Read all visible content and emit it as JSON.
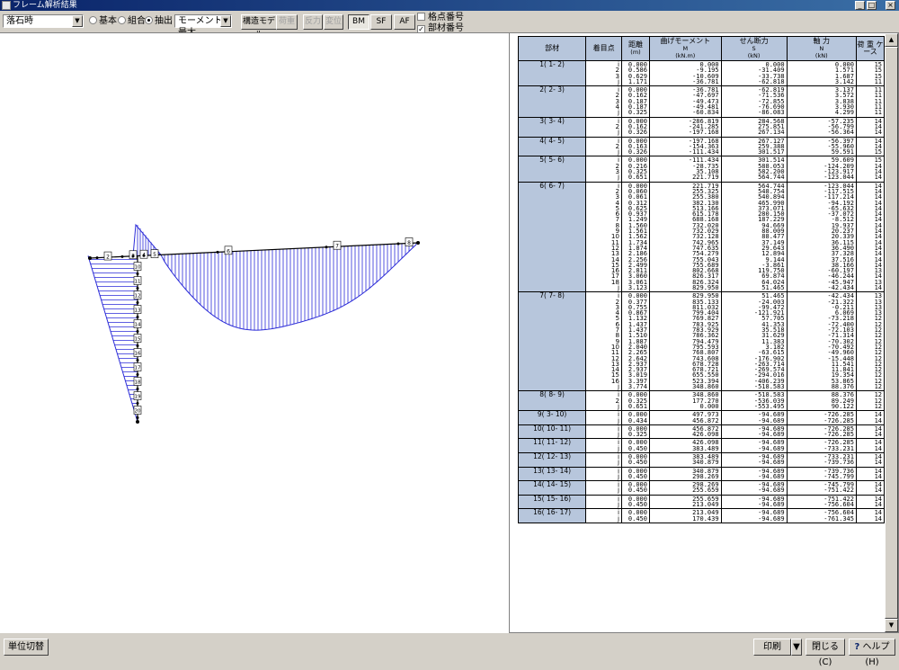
{
  "window": {
    "title": "フレーム解析結果",
    "min_label": "_",
    "max_label": "□",
    "close_label": "×"
  },
  "toolbar": {
    "case_select": "落石時",
    "radio_basic": "基本",
    "radio_combo": "組合",
    "radio_extract": "抽出",
    "selected_radio": "抽出",
    "moment_select": "モーメント最大",
    "btn_model": "構造モデル",
    "btn_load": "荷重",
    "btn_reaction": "反力",
    "btn_disp": "変位",
    "btn_bm": "BM",
    "btn_sf": "SF",
    "btn_af": "AF",
    "chk_node": "格点番号",
    "chk_node_checked": false,
    "chk_member": "部材番号",
    "chk_member_checked": true
  },
  "table": {
    "headers": {
      "member": "部材",
      "point": "着目点",
      "dist": "距離",
      "dist_unit": "(m)",
      "moment": "曲げモーメント",
      "moment_sym": "M",
      "moment_unit": "(kN.m)",
      "shear": "せん断力",
      "shear_sym": "S",
      "shear_unit": "(kN)",
      "axial": "軸 力",
      "axial_sym": "N",
      "axial_unit": "(kN)",
      "case": "荷 重 ケース"
    },
    "blocks": [
      {
        "member": "1( 1- 2)",
        "rows": [
          [
            "i",
            "0.000",
            "0.000",
            "0.000",
            "0.000",
            "15"
          ],
          [
            "2",
            "0.586",
            "-9.195",
            "-31.409",
            "1.571",
            "15"
          ],
          [
            "3",
            "0.629",
            "-10.609",
            "-33.738",
            "1.687",
            "15"
          ],
          [
            "j",
            "1.171",
            "-36.781",
            "-62.818",
            "3.142",
            "11"
          ]
        ]
      },
      {
        "member": "2( 2- 3)",
        "rows": [
          [
            "i",
            "0.000",
            "-36.781",
            "-62.819",
            "3.137",
            "11"
          ],
          [
            "2",
            "0.162",
            "-47.697",
            "-71.536",
            "3.572",
            "11"
          ],
          [
            "3",
            "0.187",
            "-49.473",
            "-72.855",
            "3.838",
            "11"
          ],
          [
            "4",
            "0.187",
            "-49.481",
            "-76.690",
            "3.930",
            "11"
          ],
          [
            "j",
            "0.325",
            "-60.834",
            "-86.083",
            "4.299",
            "11"
          ]
        ]
      },
      {
        "member": "3( 3- 4)",
        "rows": [
          [
            "i",
            "0.000",
            "-286.819",
            "284.568",
            "-57.235",
            "14"
          ],
          [
            "2",
            "0.162",
            "-241.285",
            "275.851",
            "-56.799",
            "14"
          ],
          [
            "j",
            "0.326",
            "-197.168",
            "267.134",
            "-56.364",
            "14"
          ]
        ]
      },
      {
        "member": "4( 4- 5)",
        "rows": [
          [
            "i",
            "0.000",
            "-197.168",
            "267.127",
            "-56.397",
            "14"
          ],
          [
            "2",
            "0.163",
            "-154.363",
            "259.388",
            "-55.960",
            "14"
          ],
          [
            "j",
            "0.326",
            "-111.434",
            "301.517",
            "59.591",
            "15"
          ]
        ]
      },
      {
        "member": "5( 5- 6)",
        "rows": [
          [
            "i",
            "0.000",
            "-111.434",
            "301.514",
            "59.609",
            "15"
          ],
          [
            "2",
            "0.216",
            "-28.735",
            "588.053",
            "-124.209",
            "14"
          ],
          [
            "3",
            "0.325",
            "35.108",
            "582.200",
            "-123.917",
            "14"
          ],
          [
            "j",
            "0.651",
            "221.719",
            "564.744",
            "-123.044",
            "14"
          ]
        ]
      },
      {
        "member": "6( 6- 7)",
        "rows": [
          [
            "i",
            "0.000",
            "221.719",
            "564.744",
            "-123.044",
            "14"
          ],
          [
            "2",
            "0.060",
            "255.325",
            "548.754",
            "-117.515",
            "14"
          ],
          [
            "3",
            "0.061",
            "255.380",
            "540.894",
            "-117.214",
            "14"
          ],
          [
            "4",
            "0.312",
            "382.130",
            "465.990",
            "-94.192",
            "14"
          ],
          [
            "5",
            "0.625",
            "513.166",
            "373.071",
            "-65.632",
            "14"
          ],
          [
            "6",
            "0.937",
            "615.178",
            "280.150",
            "-37.072",
            "14"
          ],
          [
            "7",
            "1.249",
            "688.168",
            "187.229",
            "-8.512",
            "14"
          ],
          [
            "8",
            "1.560",
            "732.020",
            "94.669",
            "19.937",
            "14"
          ],
          [
            "9",
            "1.561",
            "732.029",
            "88.009",
            "20.237",
            "14"
          ],
          [
            "10",
            "1.562",
            "732.128",
            "88.477",
            "20.339",
            "14"
          ],
          [
            "11",
            "1.734",
            "742.965",
            "37.149",
            "36.115",
            "14"
          ],
          [
            "12",
            "1.874",
            "747.635",
            "29.643",
            "36.490",
            "14"
          ],
          [
            "13",
            "2.186",
            "754.279",
            "12.894",
            "37.328",
            "14"
          ],
          [
            "14",
            "2.256",
            "755.043",
            "9.144",
            "37.516",
            "14"
          ],
          [
            "15",
            "2.499",
            "755.689",
            "-3.861",
            "38.166",
            "14"
          ],
          [
            "16",
            "2.811",
            "802.668",
            "119.750",
            "-60.197",
            "13"
          ],
          [
            "17",
            "3.060",
            "826.317",
            "69.874",
            "-46.244",
            "14"
          ],
          [
            "18",
            "3.061",
            "826.324",
            "64.024",
            "-45.947",
            "13"
          ],
          [
            "j",
            "3.123",
            "829.950",
            "51.465",
            "-42.434",
            "14"
          ]
        ]
      },
      {
        "member": "7( 7- 8)",
        "rows": [
          [
            "i",
            "0.000",
            "829.950",
            "51.465",
            "-42.434",
            "13"
          ],
          [
            "2",
            "0.377",
            "835.133",
            "-24.003",
            "-21.322",
            "13"
          ],
          [
            "3",
            "0.755",
            "811.032",
            "-99.472",
            "-0.211",
            "13"
          ],
          [
            "4",
            "0.867",
            "799.404",
            "-121.921",
            "6.069",
            "13"
          ],
          [
            "5",
            "1.132",
            "769.827",
            "57.705",
            "-73.218",
            "12"
          ],
          [
            "6",
            "1.437",
            "783.925",
            "41.353",
            "-72.400",
            "12"
          ],
          [
            "7",
            "1.437",
            "783.929",
            "35.518",
            "-72.103",
            "12"
          ],
          [
            "8",
            "1.510",
            "786.362",
            "31.629",
            "-71.314",
            "12"
          ],
          [
            "9",
            "1.887",
            "794.479",
            "11.383",
            "-70.302",
            "12"
          ],
          [
            "10",
            "2.040",
            "795.593",
            "3.182",
            "-70.492",
            "12"
          ],
          [
            "11",
            "2.265",
            "768.807",
            "-63.615",
            "-49.960",
            "12"
          ],
          [
            "12",
            "2.642",
            "743.608",
            "-176.902",
            "-15.448",
            "12"
          ],
          [
            "13",
            "2.937",
            "678.728",
            "-263.714",
            "11.541",
            "12"
          ],
          [
            "14",
            "2.937",
            "678.721",
            "-269.574",
            "11.841",
            "12"
          ],
          [
            "15",
            "3.019",
            "655.550",
            "-294.016",
            "19.354",
            "12"
          ],
          [
            "16",
            "3.397",
            "523.394",
            "-406.239",
            "53.865",
            "12"
          ],
          [
            "j",
            "3.774",
            "348.860",
            "-518.583",
            "88.376",
            "12"
          ]
        ]
      },
      {
        "member": "8( 8- 9)",
        "rows": [
          [
            "i",
            "0.000",
            "348.860",
            "-518.583",
            "88.376",
            "12"
          ],
          [
            "2",
            "0.325",
            "177.270",
            "-536.039",
            "89.249",
            "12"
          ],
          [
            "j",
            "0.651",
            "0.000",
            "-553.495",
            "90.122",
            "12"
          ]
        ]
      },
      {
        "member": "9( 3- 10)",
        "rows": [
          [
            "i",
            "0.000",
            "497.973",
            "-94.689",
            "-726.285",
            "14"
          ],
          [
            "j",
            "0.434",
            "456.872",
            "-94.689",
            "-726.285",
            "14"
          ]
        ]
      },
      {
        "member": "10( 10- 11)",
        "rows": [
          [
            "i",
            "0.000",
            "456.872",
            "-94.689",
            "-726.285",
            "14"
          ],
          [
            "j",
            "0.325",
            "426.098",
            "-94.689",
            "-726.285",
            "14"
          ]
        ]
      },
      {
        "member": "11( 11- 12)",
        "rows": [
          [
            "i",
            "0.000",
            "426.098",
            "-94.689",
            "-726.285",
            "14"
          ],
          [
            "j",
            "0.450",
            "383.489",
            "-94.689",
            "-733.231",
            "14"
          ]
        ]
      },
      {
        "member": "12( 12- 13)",
        "rows": [
          [
            "i",
            "0.000",
            "383.489",
            "-94.689",
            "-733.231",
            "14"
          ],
          [
            "j",
            "0.450",
            "340.879",
            "-94.689",
            "-739.736",
            "14"
          ]
        ]
      },
      {
        "member": "13( 13- 14)",
        "rows": [
          [
            "i",
            "0.000",
            "340.879",
            "-94.689",
            "-739.736",
            "14"
          ],
          [
            "j",
            "0.450",
            "298.269",
            "-94.689",
            "-745.799",
            "14"
          ]
        ]
      },
      {
        "member": "14( 14- 15)",
        "rows": [
          [
            "i",
            "0.000",
            "298.269",
            "-94.689",
            "-745.799",
            "14"
          ],
          [
            "j",
            "0.450",
            "255.659",
            "-94.689",
            "-751.422",
            "14"
          ]
        ]
      },
      {
        "member": "15( 15- 16)",
        "rows": [
          [
            "i",
            "0.000",
            "255.659",
            "-94.689",
            "-751.422",
            "14"
          ],
          [
            "j",
            "0.450",
            "213.049",
            "-94.689",
            "-756.604",
            "14"
          ]
        ]
      },
      {
        "member": "16( 16- 17)",
        "rows": [
          [
            "i",
            "0.000",
            "213.049",
            "-94.689",
            "-756.604",
            "14"
          ],
          [
            "j",
            "0.450",
            "170.439",
            "-94.689",
            "-761.345",
            "14"
          ]
        ]
      }
    ]
  },
  "diagram": {
    "member_labels_horizontal": [
      "2",
      "3",
      "4",
      "5",
      "6",
      "7",
      "8"
    ],
    "member_labels_vertical": [
      "10",
      "11",
      "12",
      "13",
      "14",
      "15",
      "16",
      "17",
      "18",
      "19",
      "20"
    ]
  },
  "statusbar": {
    "unit_switch": "単位切替",
    "print": "印刷",
    "close": "閉じる(C)",
    "help": "ヘルプ(H)",
    "help_icon": "?"
  }
}
